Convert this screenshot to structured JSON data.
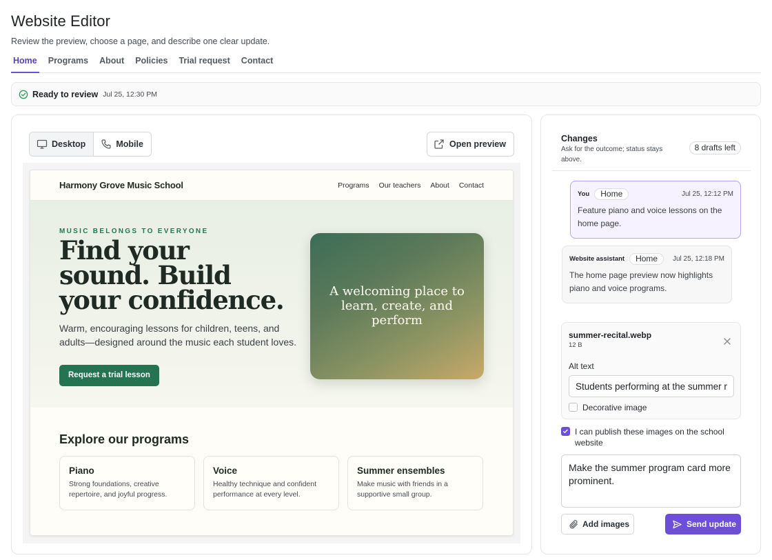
{
  "app": {
    "title": "Website Editor",
    "subtitle": "Review the preview, choose a page, and describe one clear update."
  },
  "tabs": [
    {
      "label": "Home",
      "active": true
    },
    {
      "label": "Programs",
      "active": false
    },
    {
      "label": "About",
      "active": false
    },
    {
      "label": "Policies",
      "active": false
    },
    {
      "label": "Trial request",
      "active": false
    },
    {
      "label": "Contact",
      "active": false
    }
  ],
  "status": {
    "label": "Ready to review",
    "time": "Jul 25, 12:30 PM",
    "color": "#2f9e5b"
  },
  "toolbar": {
    "desktop_label": "Desktop",
    "mobile_label": "Mobile",
    "open_preview_label": "Open preview",
    "selected_device": "Desktop"
  },
  "site": {
    "brand": "Harmony Grove Music School",
    "nav_links": [
      "Programs",
      "Our teachers",
      "About",
      "Contact"
    ],
    "hero": {
      "eyebrow": "MUSIC BELONGS TO EVERYONE",
      "title": "Find your sound. Build your confidence.",
      "description": "Warm, encouraging lessons for children, teens, and adults—designed around the music each student loves.",
      "cta_label": "Request a trial lesson",
      "image_caption": "A welcoming place to learn, create, and perform"
    },
    "programs_title": "Explore our programs",
    "programs": [
      {
        "name": "Piano",
        "description": "Strong foundations, creative repertoire, and joyful progress."
      },
      {
        "name": "Voice",
        "description": "Healthy technique and confident performance at every level."
      },
      {
        "name": "Summer ensembles",
        "description": "Make music with friends in a supportive small group."
      }
    ],
    "brand_green": "#247451"
  },
  "changes": {
    "title": "Changes",
    "subtitle": "Ask for the outcome; status stays above.",
    "drafts_left": "8 drafts left",
    "messages": [
      {
        "author": "You",
        "page": "Home",
        "time": "Jul 25, 12:12 PM",
        "text": "Feature piano and voice lessons on the home page."
      },
      {
        "author": "Website assistant",
        "page": "Home",
        "time": "Jul 25, 12:18 PM",
        "text": "The home page preview now highlights piano and voice programs."
      }
    ]
  },
  "attachment": {
    "file_name": "summer-recital.webp",
    "file_size": "12 B",
    "alt_label": "Alt text",
    "alt_value": "Students performing at the summer recital",
    "decorative_label": "Decorative image",
    "decorative_checked": false
  },
  "composer": {
    "permission_label": "I can publish these images on the school website",
    "permission_checked": true,
    "message_value": "Make the summer program card more prominent.",
    "add_images_label": "Add images",
    "send_label": "Send update"
  },
  "accent_color": "#6d4ed6"
}
